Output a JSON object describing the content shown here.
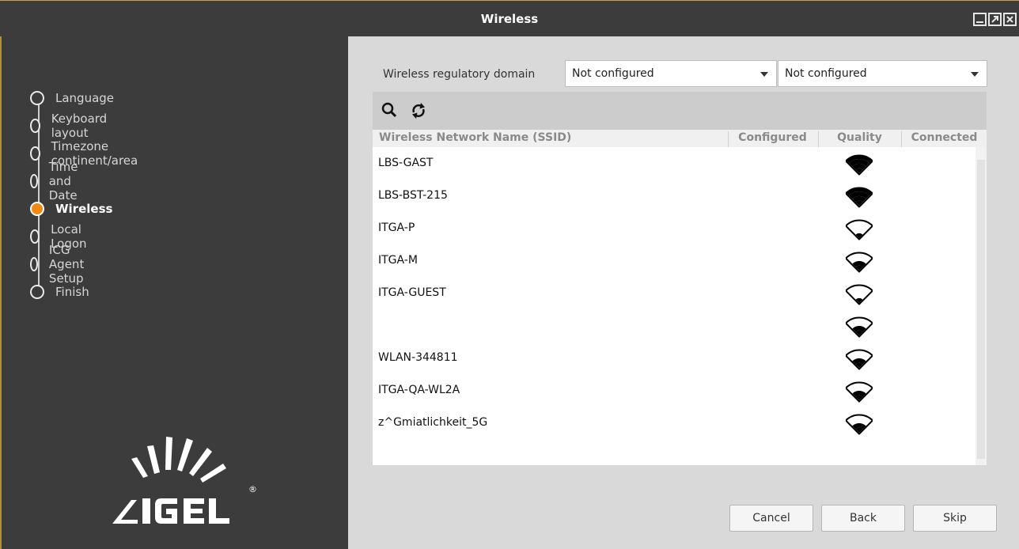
{
  "window": {
    "title": "Wireless",
    "controls": [
      "minimize-icon",
      "maximize-icon",
      "close-icon"
    ]
  },
  "steps": [
    {
      "label": "Language",
      "active": false
    },
    {
      "label": "Keyboard layout",
      "active": false
    },
    {
      "label": "Timezone continent/area",
      "active": false
    },
    {
      "label": "Time and Date",
      "active": false
    },
    {
      "label": "Wireless",
      "active": true
    },
    {
      "label": "Local Logon",
      "active": false
    },
    {
      "label": "ICG Agent Setup",
      "active": false
    },
    {
      "label": "Finish",
      "active": false
    }
  ],
  "logo": {
    "text": "IGEL",
    "mark": "®"
  },
  "regulatory": {
    "label": "Wireless regulatory domain",
    "select1": "Not configured",
    "select2": "Not configured"
  },
  "toolbar": {
    "icons": [
      "search-icon",
      "refresh-icon"
    ]
  },
  "table": {
    "columns": [
      "Wireless Network Name (SSID)",
      "Configured",
      "Quality",
      "Connected"
    ],
    "rows": [
      {
        "ssid": "LBS-GAST",
        "quality": 4
      },
      {
        "ssid": "LBS-BST-215",
        "quality": 4
      },
      {
        "ssid": "ITGA-P",
        "quality": 1
      },
      {
        "ssid": "ITGA-M",
        "quality": 2
      },
      {
        "ssid": "ITGA-GUEST",
        "quality": 1
      },
      {
        "ssid": "",
        "quality": 2
      },
      {
        "ssid": "WLAN-344811",
        "quality": 2
      },
      {
        "ssid": "ITGA-QA-WL2A",
        "quality": 2
      },
      {
        "ssid": "z^Gmiatlichkeit_5G",
        "quality": 2
      }
    ]
  },
  "buttons": {
    "cancel": "Cancel",
    "back": "Back",
    "skip": "Skip"
  },
  "colors": {
    "accent": "#f08a10",
    "background": "#3c3c3c",
    "panel": "#d9d9d9"
  }
}
